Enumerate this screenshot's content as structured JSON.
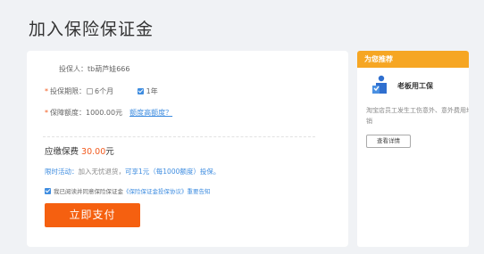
{
  "page": {
    "title": "加入保险保证金"
  },
  "form": {
    "insured_label": "投保人：",
    "insured_value": "tb葫芦娃666",
    "period_label": "投保期限：",
    "period_options": [
      "6个月",
      "1年"
    ],
    "period_selected": "1年",
    "amount_label": "保障额度：",
    "amount_value": "1000.00元",
    "amount_link": "额度高额度？",
    "fee_label": "应缴保费",
    "fee_value": "30.00",
    "fee_unit": "元",
    "promo_prefix": "限时活动：",
    "promo_mid": "加入无忧退货，",
    "promo_highlight": "可享1元（每1000额度）投保。",
    "agree_text": "我已阅读并同意保险保证金",
    "agree_link": "《保险保证金投保协议》",
    "agree_link2": "重要告知",
    "pay_button": "立即支付"
  },
  "sidebar": {
    "header": "为您推荐",
    "icon": "worker-icon",
    "product": "老板用工保",
    "desc": "淘宝店员工发生工伤意外、意外费用均可报销",
    "button": "查看详情"
  },
  "colors": {
    "accent": "#f56010",
    "link": "#3f8de0",
    "side_header": "#f6a623"
  }
}
